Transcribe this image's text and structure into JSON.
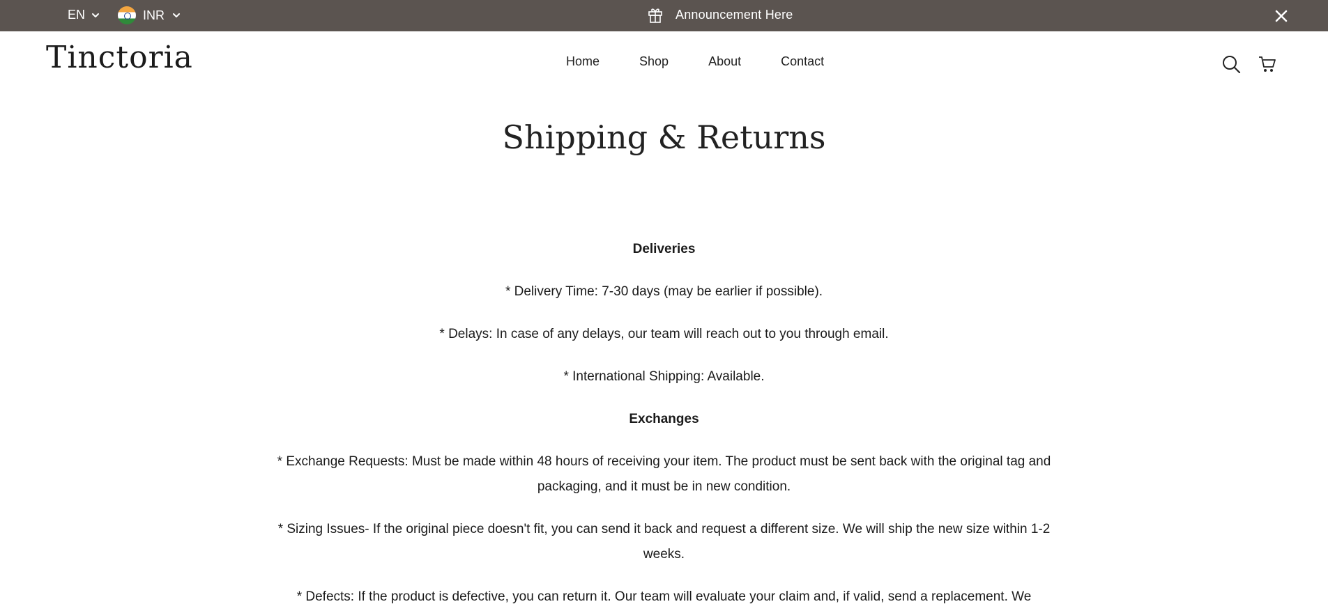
{
  "topbar": {
    "language": "EN",
    "currency": "INR",
    "announcement": "Announcement Here"
  },
  "header": {
    "logo": "Tinctoria",
    "nav": [
      "Home",
      "Shop",
      "About",
      "Contact"
    ]
  },
  "page": {
    "title": "Shipping & Returns",
    "sections": [
      {
        "heading": "Deliveries",
        "items": [
          "* Delivery Time: 7-30 days (may be earlier if possible).",
          "* Delays: In case of any delays, our team will reach out to you through email.",
          "* International Shipping: Available."
        ]
      },
      {
        "heading": "Exchanges",
        "items": [
          "* Exchange Requests: Must be made within 48 hours of receiving your item. The product must be sent back with the original tag and packaging, and it must be in new condition.",
          "* Sizing Issues- If the original piece doesn't fit, you can send it back and request a different size. We will ship the new size within 1-2 weeks.",
          "* Defects: If the product is defective, you can return it. Our team will evaluate your claim and, if valid, send a replacement. We"
        ]
      }
    ]
  },
  "colors": {
    "topbar_bg": "#5b5450",
    "text": "#1a1a1a",
    "logo_leaf": "#2f5a2c"
  }
}
